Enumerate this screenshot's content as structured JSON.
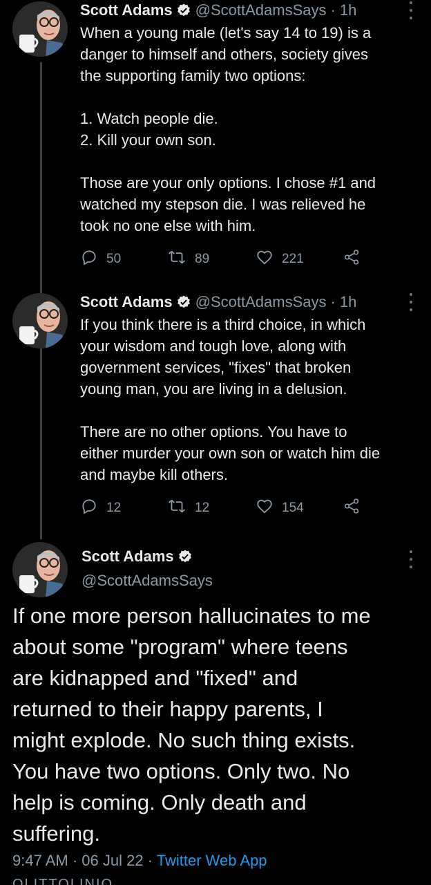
{
  "tweets": [
    {
      "author": "Scott Adams",
      "handle": "@ScottAdamsSays",
      "separator": "·",
      "time": "1h",
      "lines": [
        [
          "When a young male (let's say 14 to 19) is a",
          "danger to himself and others, society gives",
          "the supporting family two options:"
        ],
        [
          "1. Watch people die.",
          "2. Kill your own son."
        ],
        [
          "Those are your only options. I chose #1 and",
          "watched my stepson die. I was relieved he",
          "took no one else with him."
        ]
      ],
      "replies": "50",
      "retweets": "89",
      "likes": "221"
    },
    {
      "author": "Scott Adams",
      "handle": "@ScottAdamsSays",
      "separator": "·",
      "time": "1h",
      "lines": [
        [
          "If you think there is a third choice, in which",
          "your wisdom and tough love, along with",
          "government services, \"fixes\" that broken",
          "young man, you are living in a delusion."
        ],
        [
          "There are no other options. You have to",
          "either murder your own son or watch him die",
          "and maybe kill others."
        ]
      ],
      "replies": "12",
      "retweets": "12",
      "likes": "154"
    }
  ],
  "main_tweet": {
    "author": "Scott Adams",
    "handle": "@ScottAdamsSays",
    "lines": [
      "If one more person hallucinates to me",
      "about some \"program\" where teens",
      "are kidnapped and \"fixed\" and",
      "returned to their happy parents, I",
      "might explode. No such thing exists.",
      "You have two options. Only two. No",
      "help is coming. Only death and",
      "suffering."
    ],
    "time": "9:47 AM",
    "separator": "·",
    "date": "06 Jul 22",
    "app": "Twitter Web App",
    "cut_off_text": "OLITTOLINIO"
  },
  "colors": {
    "background": "#000000",
    "text": "#e7e9ea",
    "secondary": "#8b98a5",
    "accent": "#1d9bf0"
  },
  "icons": [
    "verified-icon",
    "more-icon",
    "reply-icon",
    "retweet-icon",
    "like-icon",
    "share-icon"
  ]
}
